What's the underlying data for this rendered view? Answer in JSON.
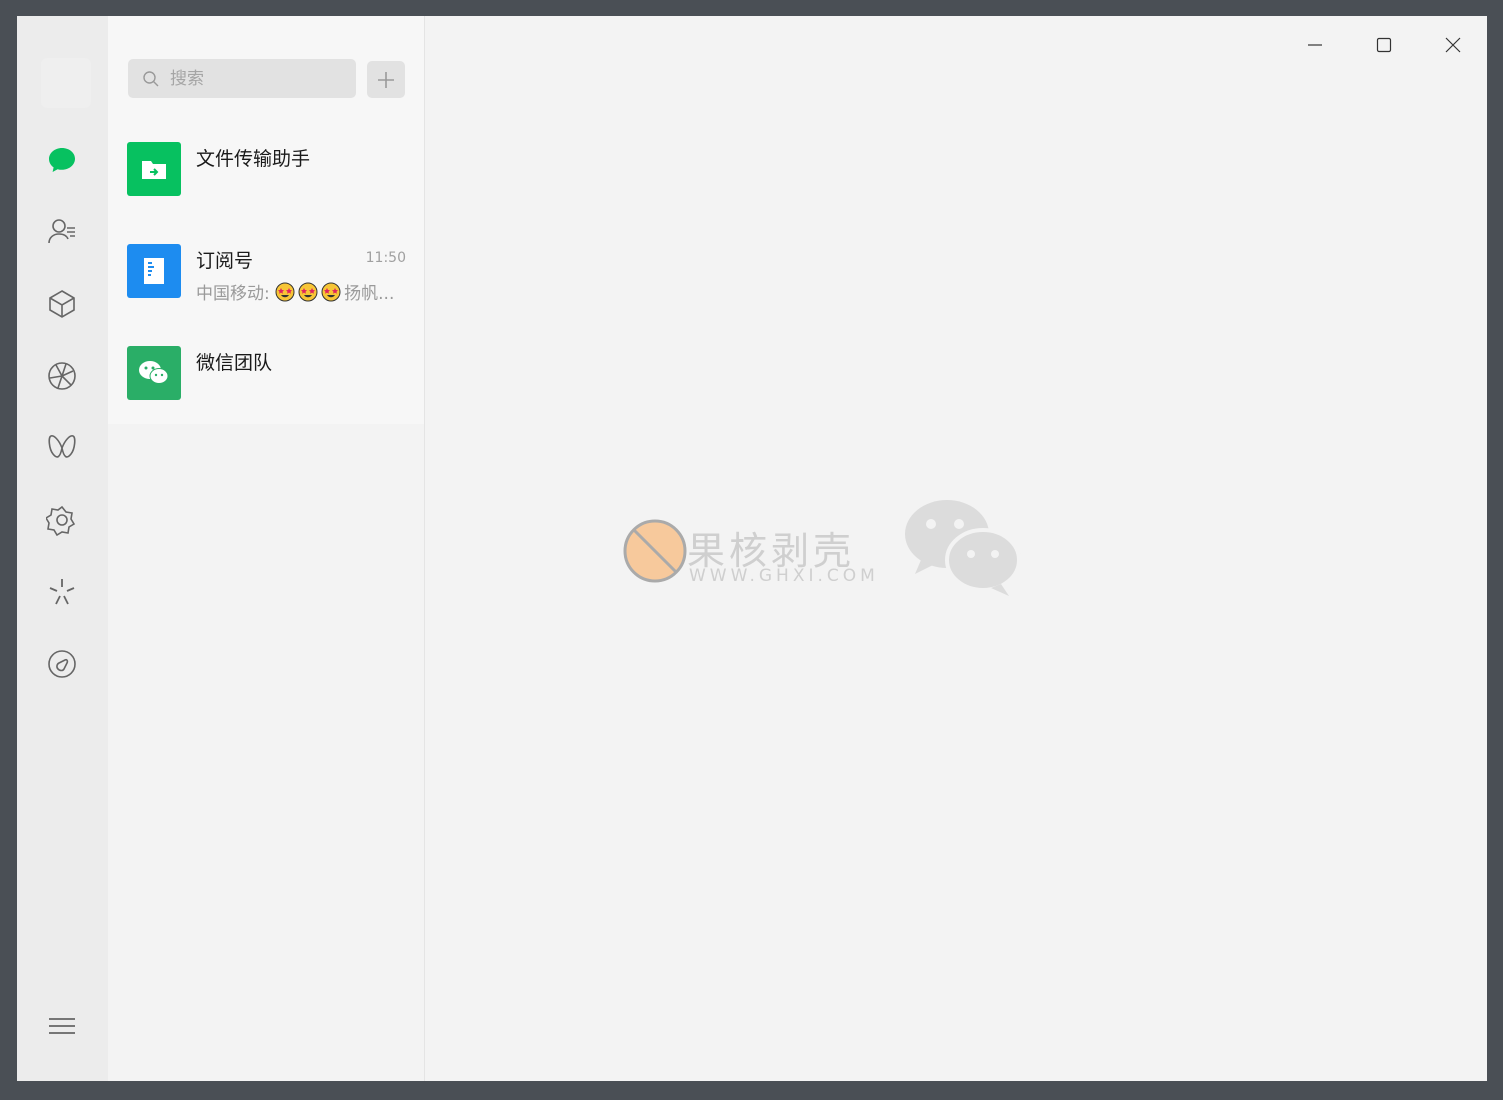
{
  "search": {
    "placeholder": "搜索"
  },
  "rail": {
    "icons": [
      "chat-bubble-icon",
      "contacts-icon",
      "box-icon",
      "aperture-icon",
      "butterfly-icon",
      "gear-flower-icon",
      "sparkle-icon",
      "channel-icon",
      "menu-icon"
    ],
    "active_color": "#07c160"
  },
  "chats": [
    {
      "name": "文件传输助手",
      "time": "",
      "preview": "",
      "avatar_color": "#07c160"
    },
    {
      "name": "订阅号",
      "time": "11:50",
      "preview_prefix": "中国移动: ",
      "preview_suffix": "扬帆...",
      "avatar_color": "#1d8cf0"
    },
    {
      "name": "微信团队",
      "time": "",
      "preview": "",
      "avatar_color": "#2aae67"
    }
  ],
  "watermark": {
    "title": "果核剥壳",
    "subtitle": "WWW.GHXI.COM"
  }
}
